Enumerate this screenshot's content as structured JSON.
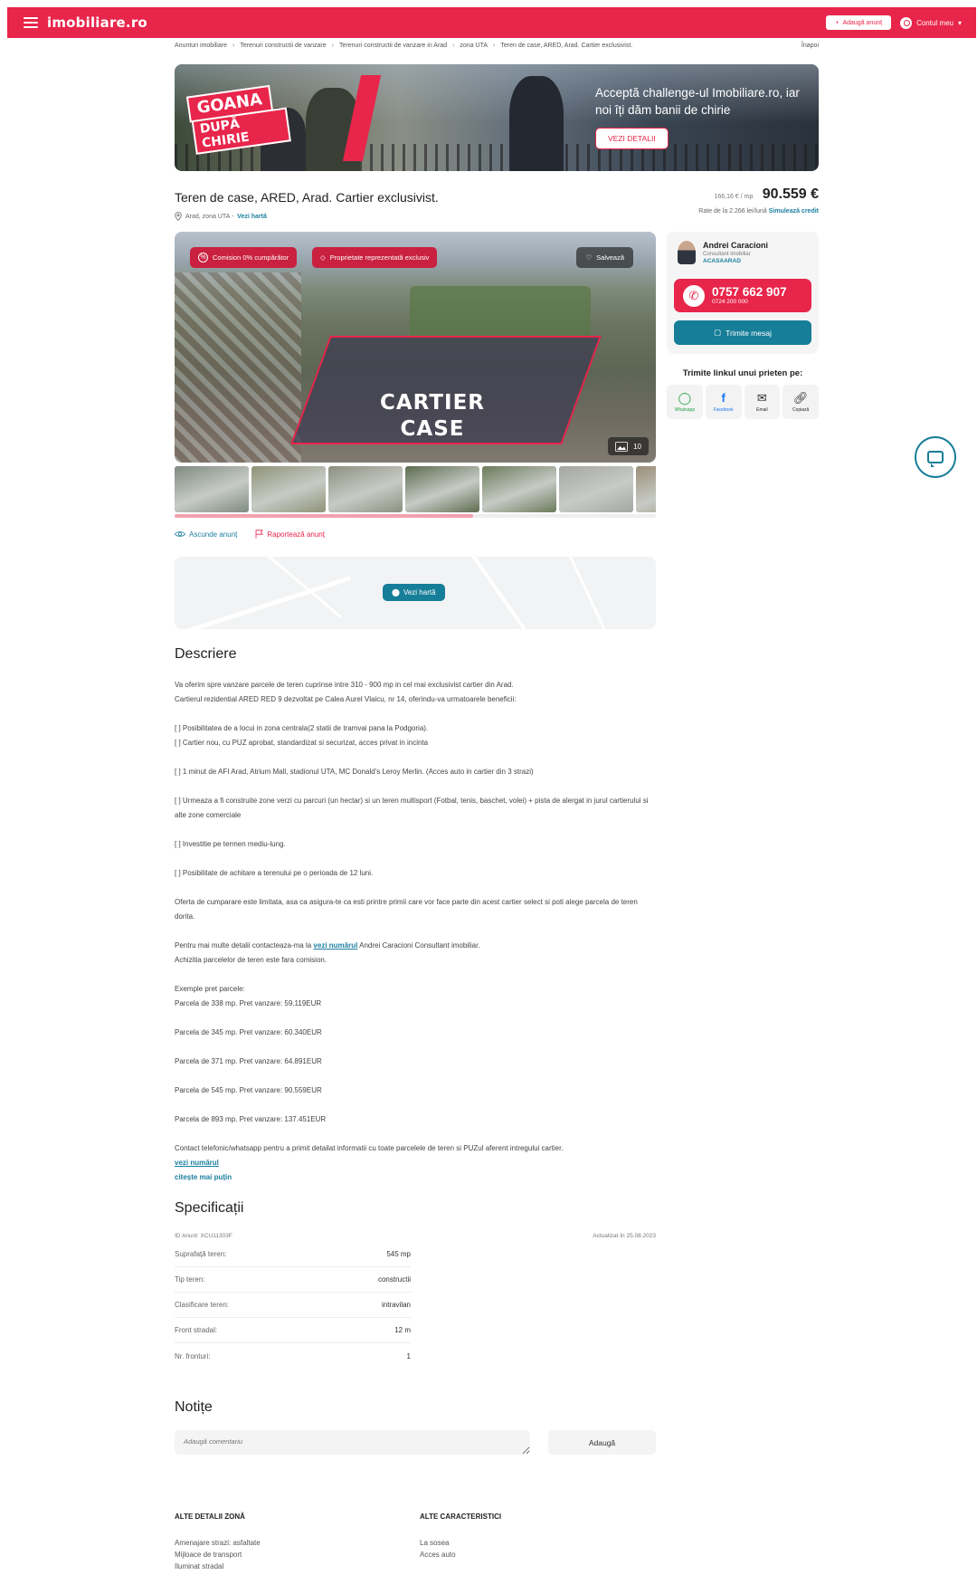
{
  "header": {
    "logo": "imobiliare.ro",
    "add_label": "Adaugă anunț",
    "account_label": "Contul meu"
  },
  "breadcrumb": {
    "items": [
      "Anunturi imobiliare",
      "Terenuri constructii de vanzare",
      "Terenuri constructii de vanzare in Arad",
      "zona UTA",
      "Teren de case, ARED, Arad. Cartier exclusivist."
    ],
    "back": "Înapoi"
  },
  "banner": {
    "badge_line1": "GOANA",
    "badge_line2": "DUPĂ CHIRIE",
    "text": "Acceptă challenge-ul Imobiliare.ro, iar noi îți dăm banii de chirie",
    "button": "VEZI DETALII"
  },
  "listing": {
    "title": "Teren de case, ARED, Arad. Cartier exclusivist.",
    "location": "Arad, zona UTA -",
    "map_link": "Vezi hartă",
    "price_per_m": "166,16 € / mp",
    "price": "90.559 €",
    "rates_text": "Rate de la 2.266 lei/lună",
    "rates_link": "Simulează credit"
  },
  "photo": {
    "badge_commission": "Comision 0% cumpărător",
    "badge_exclusive": "Proprietate reprezentată exclusiv",
    "save_label": "Salvează",
    "overlay_line1": "CARTIER",
    "overlay_line2": "CASE",
    "count": "10",
    "gallery_progress": 0.62,
    "thumb_colors": [
      "#7f8a80",
      "#8e9378",
      "#8c9080",
      "#5d6c4f",
      "#6b7a5a",
      "#a4a6a2",
      "#9a8e78"
    ]
  },
  "actions": {
    "hide_label": "Ascunde anunț",
    "report_label": "Raportează anunț"
  },
  "map": {
    "button": "Vezi hartă"
  },
  "agent": {
    "name": "Andrei Caracioni",
    "role": "Consultant imobiliar",
    "agency": "ACASAARAD",
    "phone": "0757 662 907",
    "phone_secondary": "0724 200 000",
    "message_label": "Trimite mesaj"
  },
  "share": {
    "title": "Trimite linkul unui prieten pe:",
    "items": [
      {
        "label": "Whatsapp",
        "icon": "whatsapp-icon",
        "color": "#25a244"
      },
      {
        "label": "Facebook",
        "icon": "facebook-icon",
        "color": "#1877f2"
      },
      {
        "label": "Email",
        "icon": "mail-icon",
        "color": "#444444"
      },
      {
        "label": "Copiază",
        "icon": "link-icon",
        "color": "#444444"
      }
    ]
  },
  "description": {
    "heading": "Descriere",
    "p1": "Va oferim spre vanzare parcele de teren cuprinse intre 310 - 900 mp in cel mai exclusivist cartier din Arad.",
    "p2": "Cartierul rezidential ARED RED 9 dezvoltat pe Calea Aurel Vlaicu, nr 14, oferindu-va urmatoarele beneficii:",
    "p3": "[ ] Posibilitatea de a locui in zona centrala(2 statii de tramvai pana la Podgoria).",
    "p4": "[ ] Cartier nou, cu PUZ aprobat, standardizat si securizat, acces privat in incinta",
    "p5": "[ ] 1 minut de AFI Arad, Atrium Mall, stadionul UTA, MC Donald's Leroy Merlin. (Acces auto in cartier din 3 strazi)",
    "p6": "[ ] Urmeaza a fi construite zone verzi cu parcuri (un hectar) si un teren multisport (Fotbal, tenis, baschet, volei) + pista de alergat in jurul cartierului si alte zone comerciale",
    "p7": "[ ] Investitie pe termen mediu-lung.",
    "p8": "[ ] Posibilitate de achitare a terenului pe o perioada de 12 luni.",
    "p9": "Oferta de cumparare este limitata, asa ca asigura-te ca esti printre primii care vor face parte din acest cartier select si poti alege parcela de teren dorita.",
    "p10a": "Pentru mai multe detalii contacteaza-ma la",
    "p10link": "vezi numărul",
    "p10b": "Andrei Caracioni Consultant imobiliar.",
    "p11": "Achizitia parcelelor de teren este fara comision.",
    "p12": "Exemple pret parcele:",
    "p13": "Parcela de 338 mp. Pret vanzare: 59.119EUR",
    "p14": "Parcela de 345 mp. Pret vanzare: 60.340EUR",
    "p15": "Parcela de 371 mp. Pret vanzare: 64.891EUR",
    "p16": "Parcela de 545 mp. Pret vanzare: 90.559EUR",
    "p17": "Parcela de 893 mp. Pret vanzare: 137.451EUR",
    "p18": "Contact telefonic/whatsapp pentru a primit detailat informatii cu toate parcelele de teren si PUZul aferent intregului cartier.",
    "p18link": "vezi numărul",
    "read_less": "citește mai puțin"
  },
  "specs": {
    "heading": "Specificații",
    "id": "ID Anunt: XCU11303F",
    "updated": "Actualizat în 25.08.2023",
    "rows": [
      {
        "k": "Suprafață teren:",
        "v": "545 mp"
      },
      {
        "k": "Tip teren:",
        "v": "constructii"
      },
      {
        "k": "Clasificare teren:",
        "v": "intravilan"
      },
      {
        "k": "Front stradal:",
        "v": "12 m"
      },
      {
        "k": "Nr. fronturi:",
        "v": "1"
      }
    ]
  },
  "notes": {
    "heading": "Notițe",
    "placeholder": "Adaugă comentariu",
    "button": "Adaugă"
  },
  "zone": {
    "heading": "ALTE DETALII ZONĂ",
    "items": [
      "Amenajare strazi: asfaltate",
      "Mijloace de transport",
      "Iluminat stradal"
    ]
  },
  "other": {
    "heading": "ALTE CARACTERISTICI",
    "items": [
      "La sosea",
      "Acces auto"
    ]
  }
}
